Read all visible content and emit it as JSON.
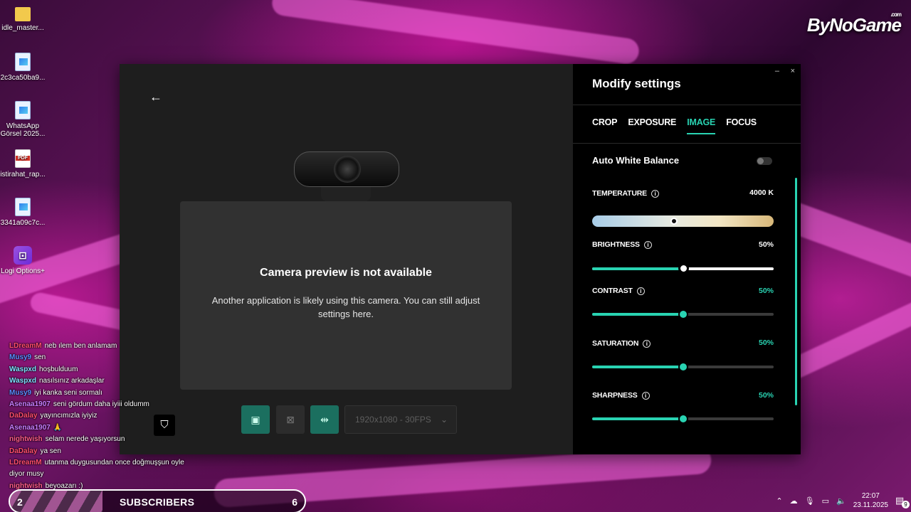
{
  "desktop": {
    "icons": [
      {
        "label": "idle_master...",
        "kind": "folder"
      },
      {
        "label": "2c3ca50ba9...",
        "kind": "image"
      },
      {
        "label": "WhatsApp Görsel 2025...",
        "kind": "image"
      },
      {
        "label": "istirahat_rap...",
        "kind": "pdf"
      },
      {
        "label": "3341a09c7c...",
        "kind": "image"
      },
      {
        "label": "Logi Options+",
        "kind": "logi"
      }
    ],
    "brand_logo": "ByNoGame",
    "brand_suffix": ".com"
  },
  "app": {
    "preview": {
      "title": "Camera preview is not available",
      "message": "Another application is likely using this camera. You can still adjust settings here."
    },
    "resolution": "1920x1080 - 30FPS",
    "panel": {
      "title": "Modify settings",
      "minimize": "–",
      "close": "×",
      "tabs": [
        "CROP",
        "EXPOSURE",
        "IMAGE",
        "FOCUS"
      ],
      "active_tab": "IMAGE",
      "auto_white_balance": {
        "label": "Auto White Balance",
        "enabled": false
      },
      "temperature": {
        "label": "TEMPERATURE",
        "value": "4000 K",
        "position": 0.45
      },
      "brightness": {
        "label": "BRIGHTNESS",
        "value": "50%",
        "level": 0.5
      },
      "contrast": {
        "label": "CONTRAST",
        "value": "50%",
        "level": 0.5
      },
      "saturation": {
        "label": "SATURATION",
        "value": "50%",
        "level": 0.5
      },
      "sharpness": {
        "label": "SHARPNESS",
        "value": "50%",
        "level": 0.5
      }
    },
    "accent_color": "#29d3b2"
  },
  "chat": [
    {
      "user": "LDreamM",
      "color": "#ff4d6d",
      "text": "neb ılem ben anlamam"
    },
    {
      "user": "Musy9",
      "color": "#5b8cff",
      "text": "sen"
    },
    {
      "user": "Waspxd",
      "color": "#7ee0ff",
      "text": "hoşbulduum"
    },
    {
      "user": "Waspxd",
      "color": "#7ee0ff",
      "text": "nasılsınız arkadaşlar"
    },
    {
      "user": "Musy9",
      "color": "#5b8cff",
      "text": "iyi kanka seni sormalı"
    },
    {
      "user": "Asenaa1907",
      "color": "#c77dff",
      "text": "seni gördum daha iyiii oldumm"
    },
    {
      "user": "DaDalay",
      "color": "#ff4d6d",
      "text": "yayıncımızla iyiyiz"
    },
    {
      "user": "Asenaa1907",
      "color": "#c77dff",
      "text": "🙏"
    },
    {
      "user": "nightwish",
      "color": "#ff5c8a",
      "text": "selam nerede yaşıyorsun"
    },
    {
      "user": "DaDalay",
      "color": "#ff4d6d",
      "text": "ya sen"
    },
    {
      "user": "LDreamM",
      "color": "#ff4d6d",
      "text": "utanma duygusundan once doğmuşşun oyle diyor musy"
    },
    {
      "user": "nightwish",
      "color": "#ff5c8a",
      "text": "beyoazarı :)"
    }
  ],
  "subscribers": {
    "left_count": "2",
    "label": "SUBSCRIBERS",
    "right_count": "6"
  },
  "taskbar": {
    "time": "22:07",
    "date": "23.11.2025",
    "notifications": "9"
  }
}
